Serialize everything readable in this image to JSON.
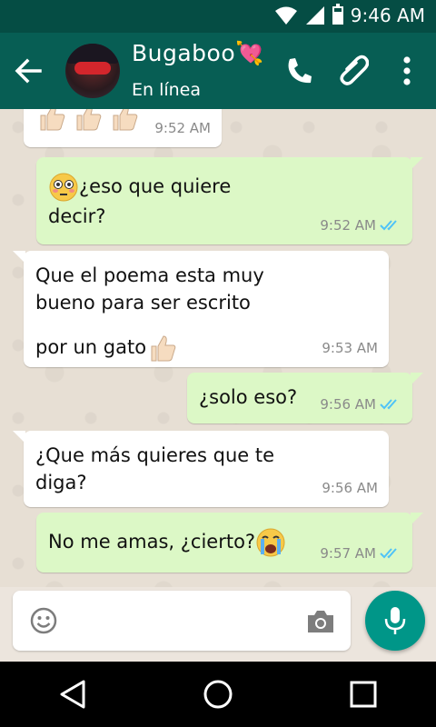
{
  "status_bar": {
    "time": "9:46 AM",
    "battery_level": 0.75
  },
  "header": {
    "contact_name": "Bugaboo💘",
    "contact_status": "En línea"
  },
  "messages": [
    {
      "direction": "incoming",
      "text": "👍🏻👍🏻👍🏻",
      "time": "9:52 AM"
    },
    {
      "direction": "outgoing",
      "lines": [
        "¿eso que quiere",
        "decir?"
      ],
      "time": "9:52 AM",
      "read": true
    },
    {
      "direction": "incoming",
      "lines": [
        "Que el poema esta muy",
        "bueno para ser escrito",
        "por un gato"
      ],
      "time": "9:53 AM"
    },
    {
      "direction": "outgoing",
      "lines": [
        "¿solo eso?"
      ],
      "time": "9:56 AM",
      "read": true
    },
    {
      "direction": "incoming",
      "lines": [
        "¿Que más quieres que te",
        "diga?"
      ],
      "time": "9:56 AM"
    },
    {
      "direction": "outgoing",
      "lines": [
        "No me amas, ¿cierto?"
      ],
      "time": "9:57 AM",
      "read": true
    }
  ],
  "input": {
    "placeholder": "",
    "value": ""
  },
  "colors": {
    "header": "#075e54",
    "status_bar": "#054d44",
    "outgoing_bubble": "#dcf8c6",
    "incoming_bubble": "#ffffff",
    "read_ticks": "#4fc3f7",
    "mic_button": "#009688"
  },
  "icons": [
    "back-arrow-icon",
    "phone-icon",
    "paperclip-icon",
    "more-vert-icon",
    "emoji-icon",
    "camera-icon",
    "mic-icon",
    "nav-back-icon",
    "nav-home-icon",
    "nav-recent-icon",
    "wifi-icon",
    "signal-icon",
    "battery-icon"
  ]
}
